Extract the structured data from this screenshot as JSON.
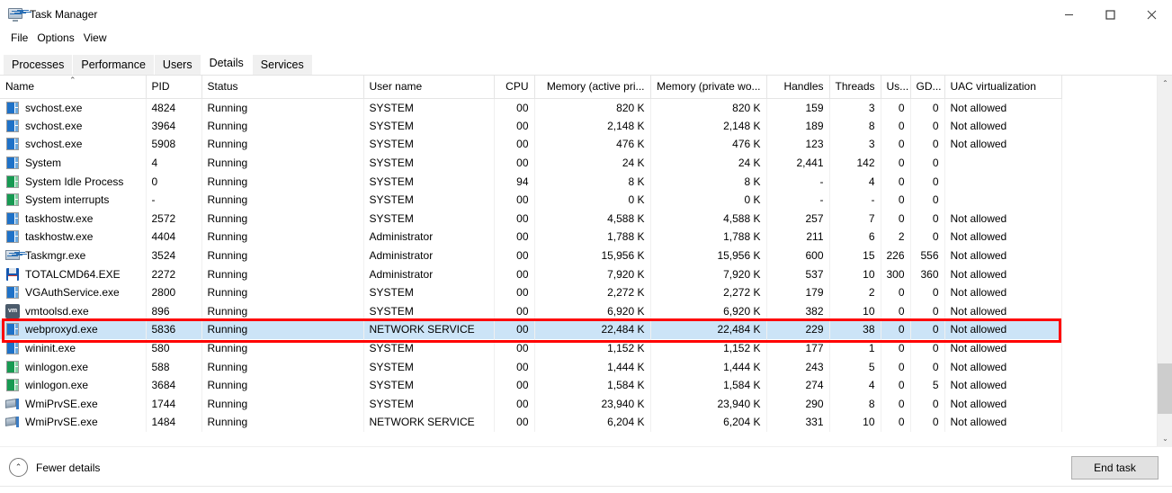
{
  "window": {
    "title": "Task Manager",
    "app_icon": "task-manager-icon",
    "controls": {
      "minimize": "–",
      "maximize": "□",
      "close": "✕"
    }
  },
  "menu": {
    "items": [
      "File",
      "Options",
      "View"
    ]
  },
  "tabs": {
    "items": [
      "Processes",
      "Performance",
      "Users",
      "Details",
      "Services"
    ],
    "active": "Details"
  },
  "table": {
    "sort_column": "Name",
    "sort_direction": "ascending",
    "columns": [
      {
        "label": "Name",
        "align": "left"
      },
      {
        "label": "PID",
        "align": "left"
      },
      {
        "label": "Status",
        "align": "left"
      },
      {
        "label": "User name",
        "align": "left"
      },
      {
        "label": "CPU",
        "align": "right"
      },
      {
        "label": "Memory (active pri...",
        "align": "right"
      },
      {
        "label": "Memory (private wo...",
        "align": "right"
      },
      {
        "label": "Handles",
        "align": "right"
      },
      {
        "label": "Threads",
        "align": "right"
      },
      {
        "label": "Us...",
        "align": "right"
      },
      {
        "label": "GD...",
        "align": "right"
      },
      {
        "label": "UAC virtualization",
        "align": "left"
      }
    ],
    "rows": [
      {
        "icon": "generic-process-icon",
        "name": "svchost.exe",
        "pid": "4824",
        "status": "Running",
        "user": "SYSTEM",
        "cpu": "00",
        "mem_active": "820 K",
        "mem_private": "820 K",
        "handles": "159",
        "threads": "3",
        "user_objects": "0",
        "gdi_objects": "0",
        "uac": "Not allowed",
        "selected": false
      },
      {
        "icon": "generic-process-icon",
        "name": "svchost.exe",
        "pid": "3964",
        "status": "Running",
        "user": "SYSTEM",
        "cpu": "00",
        "mem_active": "2,148 K",
        "mem_private": "2,148 K",
        "handles": "189",
        "threads": "8",
        "user_objects": "0",
        "gdi_objects": "0",
        "uac": "Not allowed",
        "selected": false
      },
      {
        "icon": "generic-process-icon",
        "name": "svchost.exe",
        "pid": "5908",
        "status": "Running",
        "user": "SYSTEM",
        "cpu": "00",
        "mem_active": "476 K",
        "mem_private": "476 K",
        "handles": "123",
        "threads": "3",
        "user_objects": "0",
        "gdi_objects": "0",
        "uac": "Not allowed",
        "selected": false
      },
      {
        "icon": "generic-process-icon",
        "name": "System",
        "pid": "4",
        "status": "Running",
        "user": "SYSTEM",
        "cpu": "00",
        "mem_active": "24 K",
        "mem_private": "24 K",
        "handles": "2,441",
        "threads": "142",
        "user_objects": "0",
        "gdi_objects": "0",
        "uac": "",
        "selected": false
      },
      {
        "icon": "green-process-icon",
        "name": "System Idle Process",
        "pid": "0",
        "status": "Running",
        "user": "SYSTEM",
        "cpu": "94",
        "mem_active": "8 K",
        "mem_private": "8 K",
        "handles": "-",
        "threads": "4",
        "user_objects": "0",
        "gdi_objects": "0",
        "uac": "",
        "selected": false
      },
      {
        "icon": "green-process-icon",
        "name": "System interrupts",
        "pid": "-",
        "status": "Running",
        "user": "SYSTEM",
        "cpu": "00",
        "mem_active": "0 K",
        "mem_private": "0 K",
        "handles": "-",
        "threads": "-",
        "user_objects": "0",
        "gdi_objects": "0",
        "uac": "",
        "selected": false
      },
      {
        "icon": "generic-process-icon",
        "name": "taskhostw.exe",
        "pid": "2572",
        "status": "Running",
        "user": "SYSTEM",
        "cpu": "00",
        "mem_active": "4,588 K",
        "mem_private": "4,588 K",
        "handles": "257",
        "threads": "7",
        "user_objects": "0",
        "gdi_objects": "0",
        "uac": "Not allowed",
        "selected": false
      },
      {
        "icon": "generic-process-icon",
        "name": "taskhostw.exe",
        "pid": "4404",
        "status": "Running",
        "user": "Administrator",
        "cpu": "00",
        "mem_active": "1,788 K",
        "mem_private": "1,788 K",
        "handles": "211",
        "threads": "6",
        "user_objects": "2",
        "gdi_objects": "0",
        "uac": "Not allowed",
        "selected": false
      },
      {
        "icon": "task-manager-process-icon",
        "name": "Taskmgr.exe",
        "pid": "3524",
        "status": "Running",
        "user": "Administrator",
        "cpu": "00",
        "mem_active": "15,956 K",
        "mem_private": "15,956 K",
        "handles": "600",
        "threads": "15",
        "user_objects": "226",
        "gdi_objects": "556",
        "uac": "Not allowed",
        "selected": false
      },
      {
        "icon": "floppy-disk-icon",
        "name": "TOTALCMD64.EXE",
        "pid": "2272",
        "status": "Running",
        "user": "Administrator",
        "cpu": "00",
        "mem_active": "7,920 K",
        "mem_private": "7,920 K",
        "handles": "537",
        "threads": "10",
        "user_objects": "300",
        "gdi_objects": "360",
        "uac": "Not allowed",
        "selected": false
      },
      {
        "icon": "generic-process-icon",
        "name": "VGAuthService.exe",
        "pid": "2800",
        "status": "Running",
        "user": "SYSTEM",
        "cpu": "00",
        "mem_active": "2,272 K",
        "mem_private": "2,272 K",
        "handles": "179",
        "threads": "2",
        "user_objects": "0",
        "gdi_objects": "0",
        "uac": "Not allowed",
        "selected": false
      },
      {
        "icon": "vmware-icon",
        "name": "vmtoolsd.exe",
        "pid": "896",
        "status": "Running",
        "user": "SYSTEM",
        "cpu": "00",
        "mem_active": "6,920 K",
        "mem_private": "6,920 K",
        "handles": "382",
        "threads": "10",
        "user_objects": "0",
        "gdi_objects": "0",
        "uac": "Not allowed",
        "selected": false
      },
      {
        "icon": "generic-process-icon",
        "name": "webproxyd.exe",
        "pid": "5836",
        "status": "Running",
        "user": "NETWORK SERVICE",
        "cpu": "00",
        "mem_active": "22,484 K",
        "mem_private": "22,484 K",
        "handles": "229",
        "threads": "38",
        "user_objects": "0",
        "gdi_objects": "0",
        "uac": "Not allowed",
        "selected": true
      },
      {
        "icon": "generic-process-icon",
        "name": "wininit.exe",
        "pid": "580",
        "status": "Running",
        "user": "SYSTEM",
        "cpu": "00",
        "mem_active": "1,152 K",
        "mem_private": "1,152 K",
        "handles": "177",
        "threads": "1",
        "user_objects": "0",
        "gdi_objects": "0",
        "uac": "Not allowed",
        "selected": false
      },
      {
        "icon": "green-process-icon",
        "name": "winlogon.exe",
        "pid": "588",
        "status": "Running",
        "user": "SYSTEM",
        "cpu": "00",
        "mem_active": "1,444 K",
        "mem_private": "1,444 K",
        "handles": "243",
        "threads": "5",
        "user_objects": "0",
        "gdi_objects": "0",
        "uac": "Not allowed",
        "selected": false
      },
      {
        "icon": "green-process-icon",
        "name": "winlogon.exe",
        "pid": "3684",
        "status": "Running",
        "user": "SYSTEM",
        "cpu": "00",
        "mem_active": "1,584 K",
        "mem_private": "1,584 K",
        "handles": "274",
        "threads": "4",
        "user_objects": "0",
        "gdi_objects": "5",
        "uac": "Not allowed",
        "selected": false
      },
      {
        "icon": "wmi-icon",
        "name": "WmiPrvSE.exe",
        "pid": "1744",
        "status": "Running",
        "user": "SYSTEM",
        "cpu": "00",
        "mem_active": "23,940 K",
        "mem_private": "23,940 K",
        "handles": "290",
        "threads": "8",
        "user_objects": "0",
        "gdi_objects": "0",
        "uac": "Not allowed",
        "selected": false
      },
      {
        "icon": "wmi-icon",
        "name": "WmiPrvSE.exe",
        "pid": "1484",
        "status": "Running",
        "user": "NETWORK SERVICE",
        "cpu": "00",
        "mem_active": "6,204 K",
        "mem_private": "6,204 K",
        "handles": "331",
        "threads": "10",
        "user_objects": "0",
        "gdi_objects": "0",
        "uac": "Not allowed",
        "selected": false
      }
    ]
  },
  "scrollbar": {
    "up_arrow": "⌃",
    "down_arrow": "⌄"
  },
  "footer": {
    "fewer_details_label": "Fewer details",
    "fewer_details_icon": "chevron-up-circle-icon",
    "end_task_label": "End task"
  },
  "annotation": {
    "color": "#ff0000",
    "target_row": "webproxyd.exe"
  }
}
